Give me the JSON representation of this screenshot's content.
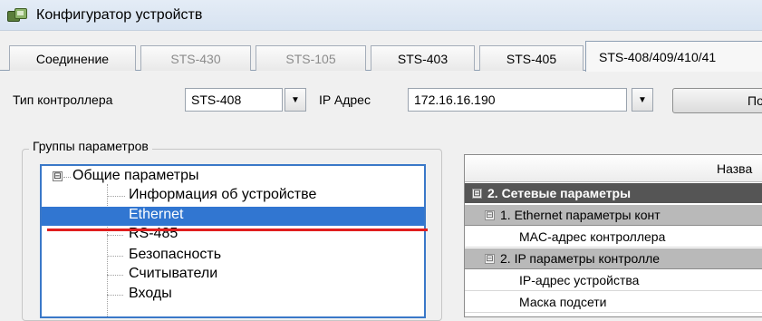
{
  "window": {
    "title": "Конфигуратор устройств",
    "icon": "devices-icon"
  },
  "tabs": [
    {
      "label": "Соединение",
      "state": "enabled"
    },
    {
      "label": "STS-430",
      "state": "disabled"
    },
    {
      "label": "STS-105",
      "state": "disabled"
    },
    {
      "label": "STS-403",
      "state": "enabled"
    },
    {
      "label": "STS-405",
      "state": "enabled"
    },
    {
      "label": "STS-408/409/410/41",
      "state": "active"
    }
  ],
  "controller": {
    "type_label": "Тип контроллера",
    "type_value": "STS-408",
    "ip_label": "IP Адрес",
    "ip_value": "172.16.16.190",
    "button_label": "По"
  },
  "groups": {
    "legend": "Группы параметров",
    "tree": [
      {
        "label": "Общие параметры",
        "expander": "⊟"
      },
      {
        "label": "Информация об устройстве"
      },
      {
        "label": "Ethernet",
        "selected": true
      },
      {
        "label": "RS-485"
      },
      {
        "label": "Безопасность"
      },
      {
        "label": "Считыватели"
      },
      {
        "label": "Входы"
      }
    ]
  },
  "grid": {
    "header": "Назва",
    "rows": [
      {
        "kind": "category",
        "label": "2. Сетевые параметры",
        "expander": "⊟"
      },
      {
        "kind": "subcategory",
        "label": "1. Ethernet параметры конт",
        "expander": "⊟"
      },
      {
        "kind": "item",
        "label": "MAC-адрес контроллера"
      },
      {
        "kind": "subcategory",
        "label": "2. IP параметры контролле",
        "expander": "⊟"
      },
      {
        "kind": "item",
        "label": "IP-адрес устройства"
      },
      {
        "kind": "item",
        "label": "Маска подсети"
      }
    ]
  },
  "colors": {
    "selection": "#3176d1",
    "annotation_underline": "#e01e1e",
    "category_bg": "#555555",
    "subcategory_bg": "#b9b9b9"
  }
}
